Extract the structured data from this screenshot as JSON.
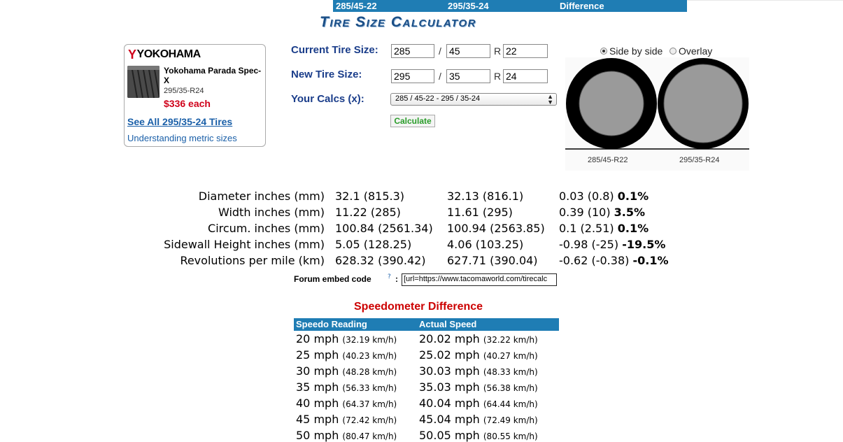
{
  "title": "Tire Size Calculator",
  "ad": {
    "brand": "YOKOHAMA",
    "brand_mark": "Y",
    "tire_name": "Yokohama Parada Spec-X",
    "tire_size": "295/35-R24",
    "price": "$336 each",
    "see_all_link": "See All 295/35-24 Tires",
    "understanding_link": "Understanding metric sizes"
  },
  "form": {
    "current_label": "Current Tire Size:",
    "new_label": "New Tire Size:",
    "calcs_label": "Your Calcs (x):",
    "current": {
      "width": "285",
      "aspect": "45",
      "rim": "22"
    },
    "new": {
      "width": "295",
      "aspect": "35",
      "rim": "24"
    },
    "slash": "/",
    "r": "R",
    "calcs_selected": "285 / 45-22 - 295 / 35-24",
    "calculate_button": "Calculate"
  },
  "view": {
    "side_by_side": "Side by side",
    "overlay": "Overlay",
    "selected": "side_by_side",
    "label_left": "285/45-R22",
    "label_right": "295/35-R24"
  },
  "results": {
    "headers": [
      "285/45-22",
      "295/35-24",
      "Difference"
    ],
    "rows": [
      {
        "label": "Diameter inches (mm)",
        "a": "32.1 (815.3)",
        "b": "32.13 (816.1)",
        "diff": "0.03 (0.8)",
        "pct": "0.1%"
      },
      {
        "label": "Width inches (mm)",
        "a": "11.22 (285)",
        "b": "11.61 (295)",
        "diff": "0.39 (10)",
        "pct": "3.5%"
      },
      {
        "label": "Circum. inches (mm)",
        "a": "100.84 (2561.34)",
        "b": "100.94 (2563.85)",
        "diff": "0.1 (2.51)",
        "pct": "0.1%"
      },
      {
        "label": "Sidewall Height inches (mm)",
        "a": "5.05 (128.25)",
        "b": "4.06 (103.25)",
        "diff": "-0.98 (-25)",
        "pct": "-19.5%"
      },
      {
        "label": "Revolutions per mile (km)",
        "a": "628.32 (390.42)",
        "b": "627.71 (390.04)",
        "diff": "-0.62 (-0.38)",
        "pct": "-0.1%"
      }
    ]
  },
  "embed": {
    "label": "Forum embed code",
    "help": "?",
    "colon": ":",
    "value": "[url=https://www.tacomaworld.com/tirecalc"
  },
  "speedo": {
    "title": "Speedometer Difference",
    "headers": [
      "Speedo Reading",
      "Actual Speed"
    ],
    "rows": [
      {
        "reading": "20 mph",
        "reading_km": "(32.19 km/h)",
        "actual": "20.02 mph",
        "actual_km": "(32.22 km/h)"
      },
      {
        "reading": "25 mph",
        "reading_km": "(40.23 km/h)",
        "actual": "25.02 mph",
        "actual_km": "(40.27 km/h)"
      },
      {
        "reading": "30 mph",
        "reading_km": "(48.28 km/h)",
        "actual": "30.03 mph",
        "actual_km": "(48.33 km/h)"
      },
      {
        "reading": "35 mph",
        "reading_km": "(56.33 km/h)",
        "actual": "35.03 mph",
        "actual_km": "(56.38 km/h)"
      },
      {
        "reading": "40 mph",
        "reading_km": "(64.37 km/h)",
        "actual": "40.04 mph",
        "actual_km": "(64.44 km/h)"
      },
      {
        "reading": "45 mph",
        "reading_km": "(72.42 km/h)",
        "actual": "45.04 mph",
        "actual_km": "(72.49 km/h)"
      },
      {
        "reading": "50 mph",
        "reading_km": "(80.47 km/h)",
        "actual": "50.05 mph",
        "actual_km": "(80.55 km/h)"
      }
    ]
  },
  "colors": {
    "header_blue": "#1f7db4",
    "title_blue": "#1a4e86",
    "label_blue": "#1a3d8a",
    "price_red": "#d0021b",
    "speedo_red": "#cc0000",
    "button_green": "#2a9d2a"
  }
}
